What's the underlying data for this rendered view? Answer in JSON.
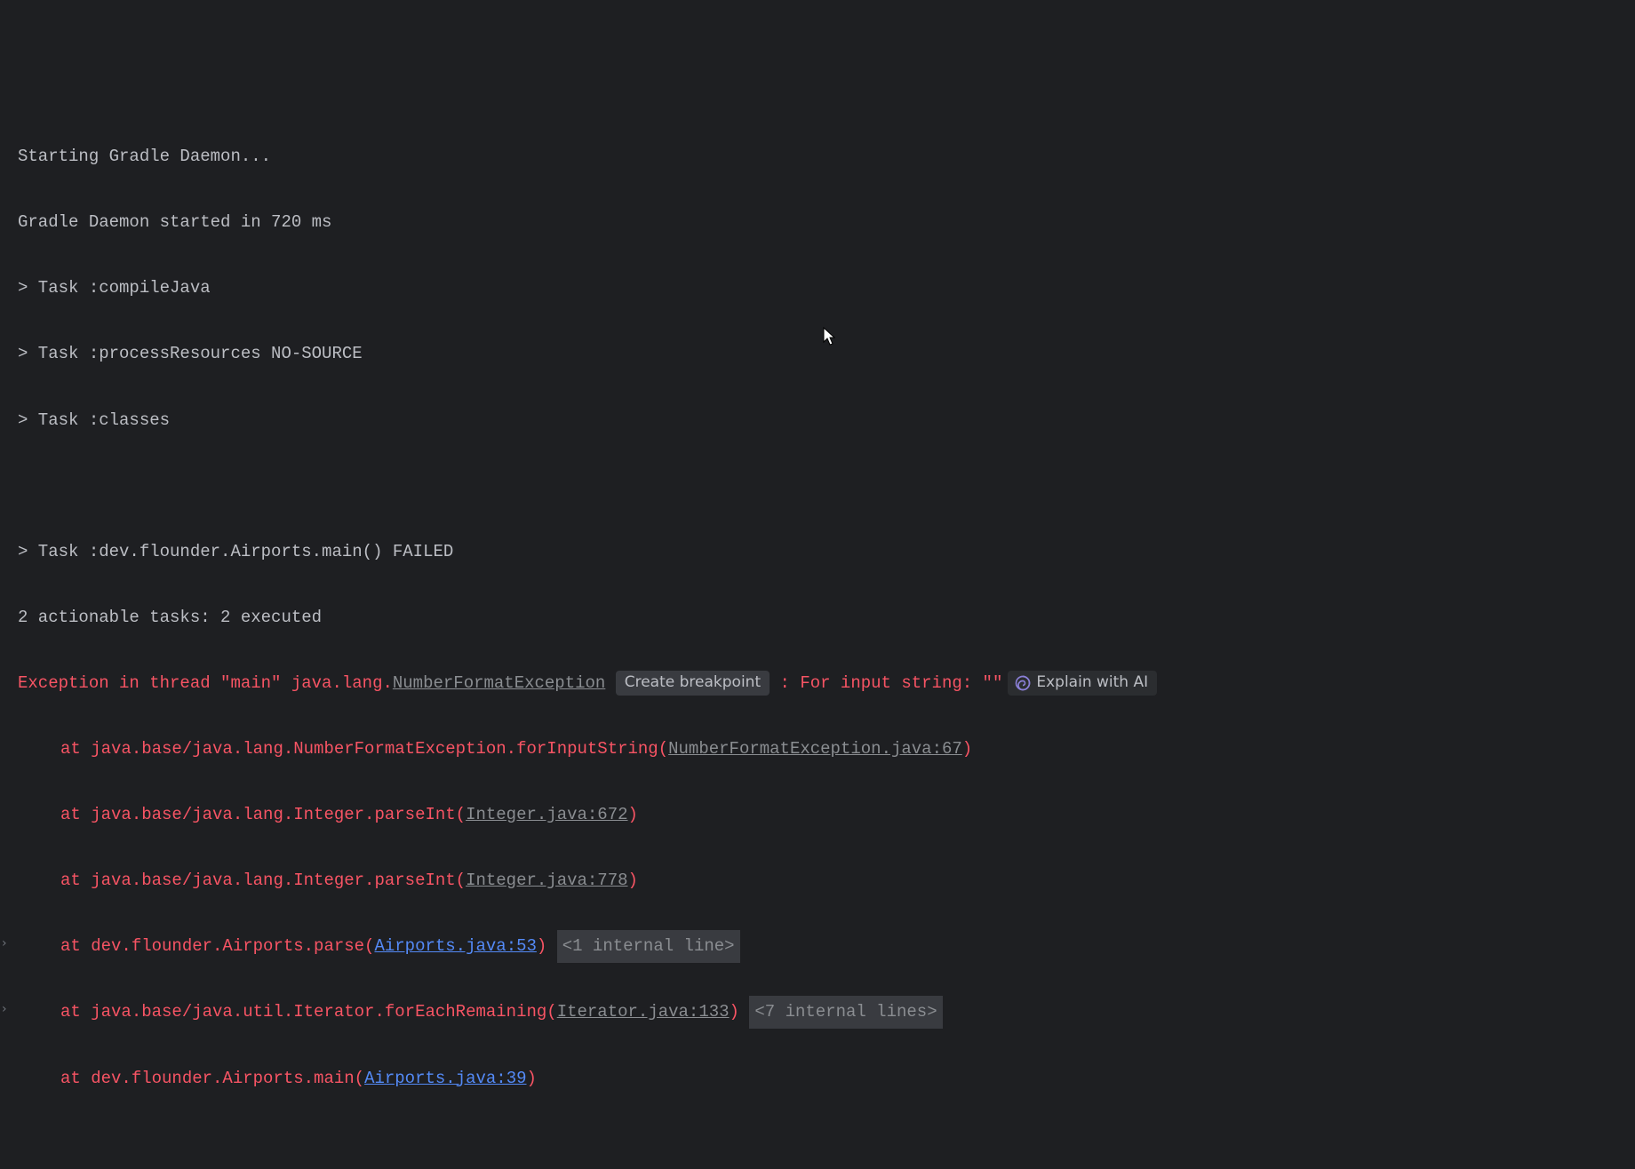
{
  "lines": {
    "l1": "Starting Gradle Daemon...",
    "l2": "Gradle Daemon started in 720 ms",
    "l3": "> Task :compileJava",
    "l4": "> Task :processResources NO-SOURCE",
    "l5": "> Task :classes",
    "l6": "> Task :dev.flounder.Airports.main() FAILED",
    "l7": "2 actionable tasks: 2 executed"
  },
  "exception": {
    "prefix": "Exception in thread \"main\" java.lang.",
    "classLink": "NumberFormatException",
    "createBreakpoint": "Create breakpoint",
    "suffix": ": For input string: \"\"",
    "explainAI": "Explain with AI"
  },
  "stack": {
    "f1": {
      "pre": "at java.base/java.lang.NumberFormatException.forInputString(",
      "link": "NumberFormatException.java:67",
      "post": ")"
    },
    "f2": {
      "pre": "at java.base/java.lang.Integer.parseInt(",
      "link": "Integer.java:672",
      "post": ")"
    },
    "f3": {
      "pre": "at java.base/java.lang.Integer.parseInt(",
      "link": "Integer.java:778",
      "post": ")"
    },
    "f4": {
      "pre": "at dev.flounder.Airports.parse(",
      "link": "Airports.java:53",
      "post": ")",
      "chip": "<1 internal line>"
    },
    "f5": {
      "pre": "at java.base/java.util.Iterator.forEachRemaining(",
      "link": "Iterator.java:133",
      "post": ")",
      "chip": "<7 internal lines>"
    },
    "f6": {
      "pre": "at dev.flounder.Airports.main(",
      "link": "Airports.java:39",
      "post": ")"
    }
  },
  "chevron": "›"
}
